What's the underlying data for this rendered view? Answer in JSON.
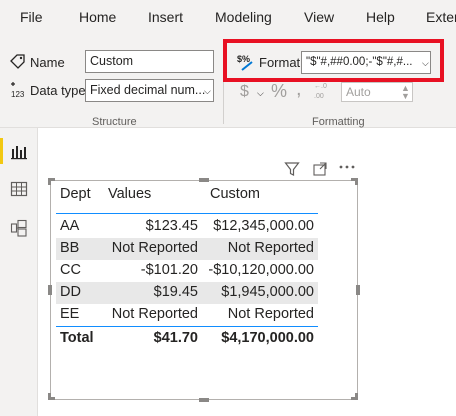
{
  "menu": [
    "File",
    "Home",
    "Insert",
    "Modeling",
    "View",
    "Help",
    "Exter"
  ],
  "structure": {
    "name_label": "Name",
    "name_value": "Custom",
    "datatype_label": "Data type",
    "datatype_value": "Fixed decimal num...",
    "group_title": "Structure"
  },
  "formatting": {
    "format_label": "Format",
    "format_value": "\"$\"#,##0.00;-\"$\"#,#...",
    "currency_symbol": "$",
    "percent_symbol": "%",
    "comma_symbol": ",",
    "auto_value": "Auto",
    "group_title": "Formatting"
  },
  "table": {
    "headers": [
      "Dept",
      "Values",
      "Custom"
    ],
    "rows": [
      [
        "AA",
        "$123.45",
        "$12,345,000.00"
      ],
      [
        "BB",
        "Not Reported",
        "Not Reported"
      ],
      [
        "CC",
        "-$101.20",
        "-$10,120,000.00"
      ],
      [
        "DD",
        "$19.45",
        "$1,945,000.00"
      ],
      [
        "EE",
        "Not Reported",
        "Not Reported"
      ]
    ],
    "total": [
      "Total",
      "$41.70",
      "$4,170,000.00"
    ]
  },
  "colors": {
    "accent_line": "#118dff",
    "highlight_border": "#e81123",
    "active_nav": "#f2c811"
  },
  "icons": [
    "name-tag-icon",
    "data-type-icon",
    "format-icon",
    "filter-icon",
    "focus-mode-icon",
    "more-options-icon",
    "report-view-icon",
    "table-view-icon",
    "model-view-icon"
  ]
}
